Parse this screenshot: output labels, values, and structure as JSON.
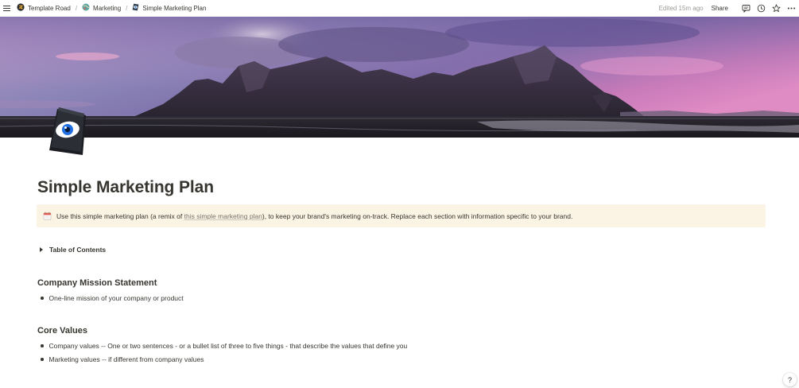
{
  "topbar": {
    "breadcrumbs": [
      {
        "label": "Template Road",
        "icon": "template-road-logo-icon"
      },
      {
        "label": "Marketing",
        "icon": "marketing-globe-icon"
      },
      {
        "label": "Simple Marketing Plan",
        "icon": "eye-page-icon"
      }
    ],
    "separator": "/",
    "edited": "Edited 15m ago",
    "share_label": "Share",
    "tools": [
      "comment-icon",
      "clock-icon",
      "star-icon",
      "more-icon"
    ]
  },
  "page": {
    "cover": "mountain-landscape-cover",
    "icon": "eye-page-icon",
    "title": "Simple Marketing Plan"
  },
  "callout": {
    "icon": "calendar-icon",
    "text_before": "Use this simple marketing plan (a remix of ",
    "link_text": "this simple marketing plan",
    "text_after": "), to keep your brand's marketing on-track. Replace each section with information specific to your brand.",
    "bg_color": "#fbf3e4"
  },
  "toggle": {
    "label": "Table of Contents"
  },
  "sections": [
    {
      "heading": "Company Mission Statement",
      "bullets": [
        "One-line mission of your company or product"
      ]
    },
    {
      "heading": "Core Values",
      "bullets": [
        "Company values -- One or two sentences - or a bullet list of three to five things - that describe the values that define you",
        "Marketing values -- if different from company values"
      ]
    }
  ],
  "help_label": "?"
}
